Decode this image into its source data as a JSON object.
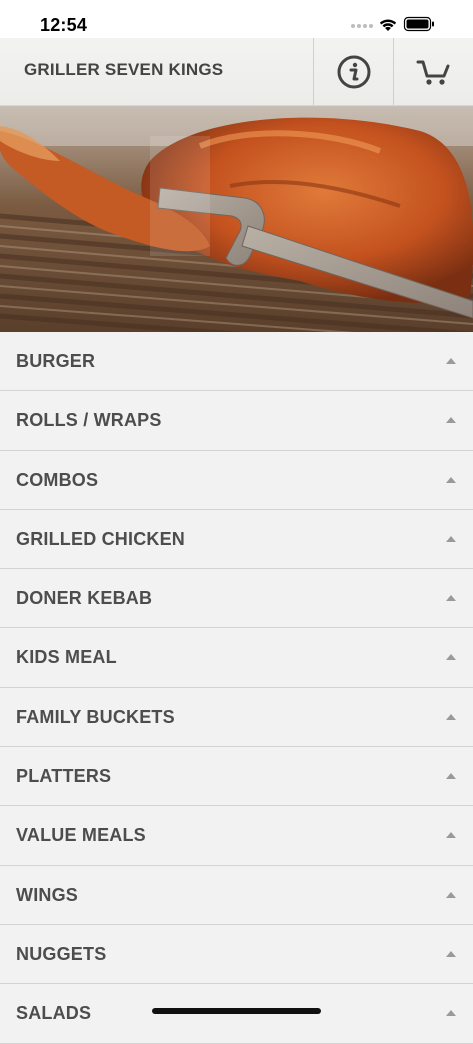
{
  "status_bar": {
    "time": "12:54",
    "icons": [
      "signal-dots-icon",
      "wifi-icon",
      "battery-icon"
    ]
  },
  "header": {
    "title": "GRILLER SEVEN KINGS",
    "info_icon": "info-icon",
    "cart_icon": "cart-icon"
  },
  "hero": {
    "description_icon": "grilled-chicken-photo"
  },
  "colors": {
    "header_text": "#444444",
    "list_text": "#4d4d4d",
    "list_bg": "#f2f2f2",
    "divider": "#d3d3d3"
  },
  "categories": [
    {
      "label": "BURGER"
    },
    {
      "label": "ROLLS / WRAPS"
    },
    {
      "label": "COMBOS"
    },
    {
      "label": "GRILLED CHICKEN"
    },
    {
      "label": "DONER KEBAB"
    },
    {
      "label": "KIDS MEAL"
    },
    {
      "label": "FAMILY BUCKETS"
    },
    {
      "label": "PLATTERS"
    },
    {
      "label": "VALUE MEALS"
    },
    {
      "label": "WINGS"
    },
    {
      "label": "NUGGETS"
    },
    {
      "label": "SALADS"
    }
  ]
}
